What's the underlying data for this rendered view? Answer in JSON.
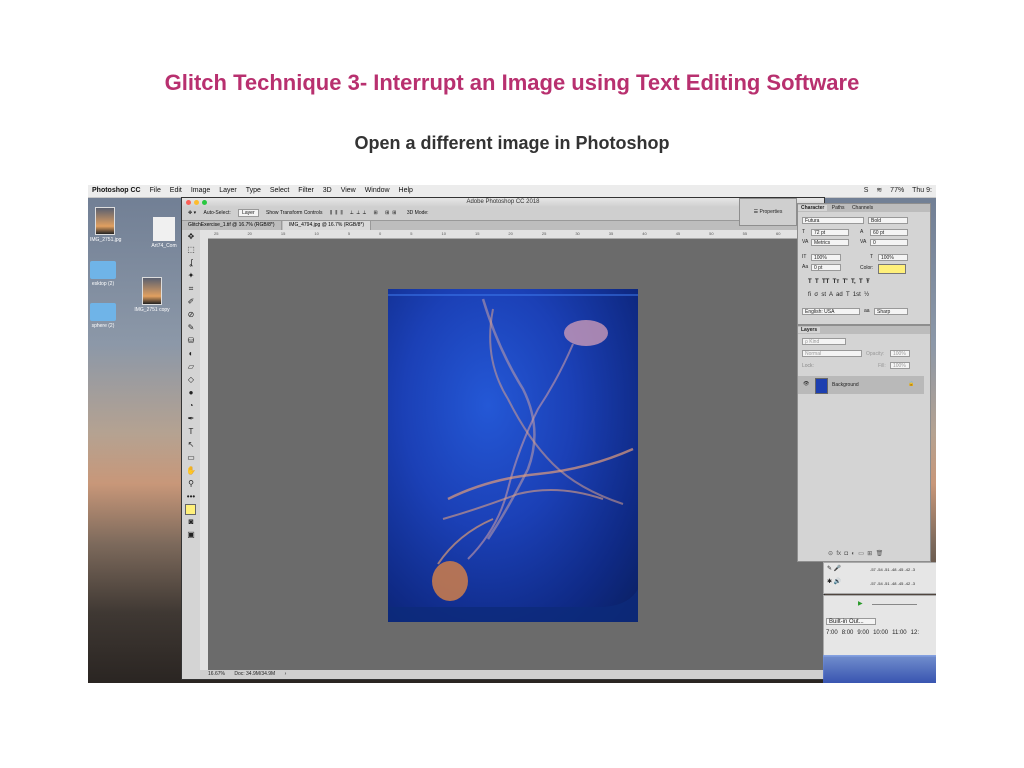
{
  "slide": {
    "title": "Glitch Technique 3- Interrupt an Image using Text Editing Software",
    "subtitle": "Open a different image in Photoshop"
  },
  "menubar": {
    "app": "Photoshop CC",
    "items": [
      "File",
      "Edit",
      "Image",
      "Layer",
      "Type",
      "Select",
      "Filter",
      "3D",
      "View",
      "Window",
      "Help"
    ],
    "battery": "77%",
    "clock": "Thu 9:"
  },
  "desktop": {
    "icons": [
      {
        "label": "IMG_2751.jpg"
      },
      {
        "label": "Art74_Com"
      },
      {
        "label": "esktop (2)"
      },
      {
        "label": "IMG_2751 copy"
      },
      {
        "label": "sphere (2)"
      }
    ]
  },
  "photoshop": {
    "window_title": "Adobe Photoshop CC 2018",
    "options": {
      "auto_select_label": "Auto-Select:",
      "auto_select_value": "Layer",
      "transform_label": "Show Transform Controls",
      "mode_3d": "3D Mode:"
    },
    "properties_label": "Properties",
    "tabs": [
      {
        "label": "GlitchExercise_1.tif @ 16.7% (RGB/8*)"
      },
      {
        "label": "IMG_4794.jpg @ 16.7% (RGB/8*)"
      }
    ],
    "ruler_ticks": [
      "25",
      "20",
      "15",
      "10",
      "5",
      "0",
      "5",
      "10",
      "15",
      "20",
      "25",
      "30",
      "35",
      "40",
      "45",
      "50",
      "55",
      "60",
      "65"
    ],
    "status": {
      "zoom": "16.67%",
      "doc": "Doc: 34.9M/34.9M"
    },
    "tools": [
      "✥",
      "⬚",
      "ʆ",
      "✦",
      "⌗",
      "✐",
      "⊘",
      "✎",
      "⛁",
      "◐",
      "▱",
      "◇",
      "●",
      "◔",
      "✒",
      "T",
      "↖",
      "▭",
      "✋",
      "⚲",
      "•••"
    ]
  },
  "character_panel": {
    "tabs": [
      "Character",
      "Paths",
      "Channels"
    ],
    "font_family": "Futura",
    "font_style": "Bold",
    "size": "72 pt",
    "leading": "60 pt",
    "kerning": "Metrics",
    "tracking": "0",
    "vertical_scale": "100%",
    "horizontal_scale": "100%",
    "baseline": "0 pt",
    "color_label": "Color:",
    "color": "#fff07a",
    "styles": "T  T  TT  Tт  T'  T,  T  Ŧ",
    "opentype": "fi  σ  st  A  ad  T  1st  ½",
    "language": "English: USA",
    "antialias": "Sharp"
  },
  "layers_panel": {
    "title": "Layers",
    "kind": "ρ Kind",
    "blend": "Normal",
    "opacity_label": "Opacity:",
    "opacity": "100%",
    "lock_label": "Lock:",
    "fill_label": "Fill:",
    "fill": "100%",
    "layers": [
      {
        "name": "Background"
      }
    ],
    "footer": "⊝  fx  ◘  ◐  ▭  ⊞  🗑"
  },
  "audio_app": {
    "meter_scale_1": "-57 -54 -51 -48 -45 -42 -3",
    "meter_scale_2": "-57 -54 -51 -48 -45 -42 -3",
    "output": "Built-in Out...",
    "times": [
      "7:00",
      "8:00",
      "9:00",
      "10:00",
      "11:00",
      "12:"
    ]
  },
  "colors": {
    "title": "#b8306f",
    "subtitle": "#333333",
    "fg_swatch": "#fff07a"
  }
}
